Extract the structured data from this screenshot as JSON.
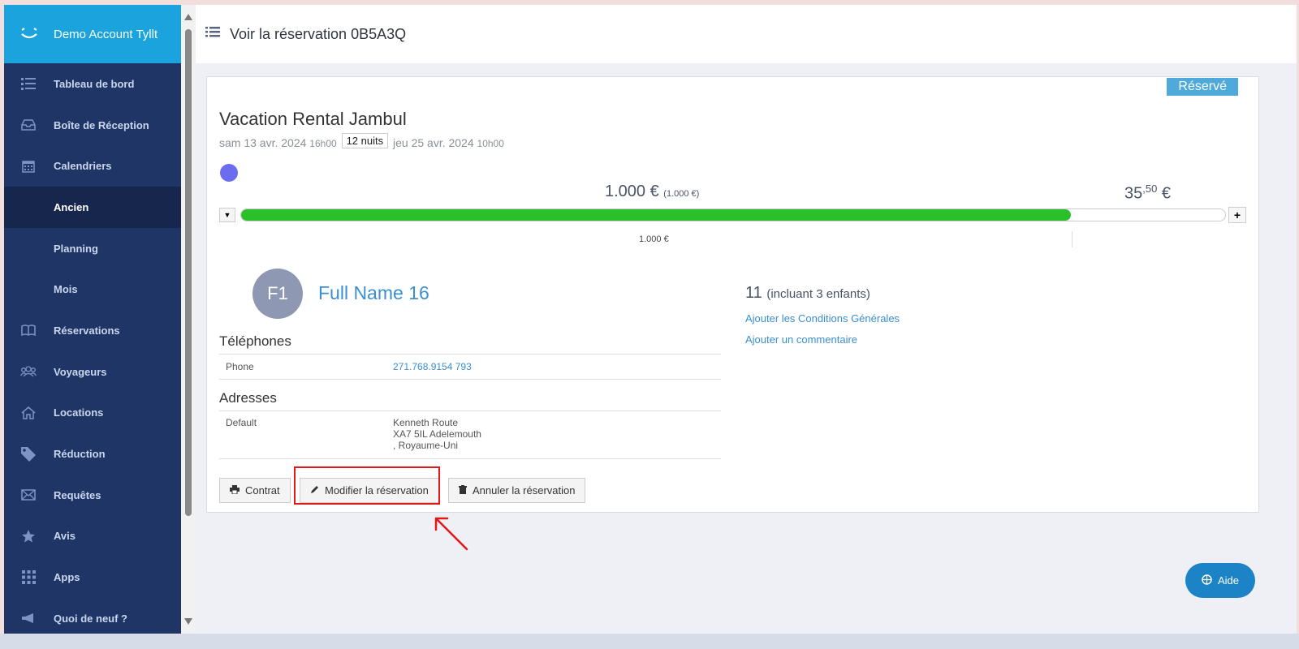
{
  "sidebar": {
    "brand": "Demo Account Tyllt",
    "items": [
      {
        "label": "Tableau de bord",
        "icon": "list-icon"
      },
      {
        "label": "Boîte de Réception",
        "icon": "inbox-icon"
      },
      {
        "label": "Calendriers",
        "icon": "calendar-icon"
      },
      {
        "label": "Ancien",
        "sub": true,
        "active": true
      },
      {
        "label": "Planning",
        "sub": true
      },
      {
        "label": "Mois",
        "sub": true
      },
      {
        "label": "Réservations",
        "icon": "book-icon"
      },
      {
        "label": "Voyageurs",
        "icon": "users-icon"
      },
      {
        "label": "Locations",
        "icon": "home-icon"
      },
      {
        "label": "Réduction",
        "icon": "tag-icon"
      },
      {
        "label": "Requêtes",
        "icon": "envelope-icon"
      },
      {
        "label": "Avis",
        "icon": "star-icon"
      },
      {
        "label": "Apps",
        "icon": "grid-icon"
      },
      {
        "label": "Quoi de neuf ?",
        "icon": "megaphone-icon"
      }
    ]
  },
  "header": {
    "title": "Voir la réservation 0B5A3Q"
  },
  "reservation": {
    "status": "Réservé",
    "property": "Vacation Rental Jambul",
    "checkin_date": "sam 13 avr. 2024",
    "checkin_time": "16h00",
    "nights": "12 nuits",
    "checkout_date": "jeu 25 avr. 2024",
    "checkout_time": "10h00",
    "amount_main": "1.000 €",
    "amount_main_sub": "(1.000 €)",
    "amount_right_int": "35",
    "amount_right_dec": ",50",
    "amount_right_cur": "€",
    "amount_paid_label": "1.000 €",
    "paid_fraction": 0.843
  },
  "guest": {
    "initials": "F1",
    "name": "Full Name 16",
    "phones_title": "Téléphones",
    "phone_label": "Phone",
    "phone_value": "271.768.9154 793",
    "addresses_title": "Adresses",
    "address_label": "Default",
    "address_line1": "Kenneth Route",
    "address_line2": "XA7 5IL Adelemouth",
    "address_line3": ", Royaume-Uni"
  },
  "guests": {
    "count": "11",
    "detail": "(incluant 3 enfants)",
    "add_terms": "Ajouter les Conditions Générales",
    "add_comment": "Ajouter un commentaire"
  },
  "actions": {
    "contract": "Contrat",
    "edit": "Modifier la réservation",
    "cancel": "Annuler la réservation"
  },
  "help": {
    "label": "Aide"
  }
}
